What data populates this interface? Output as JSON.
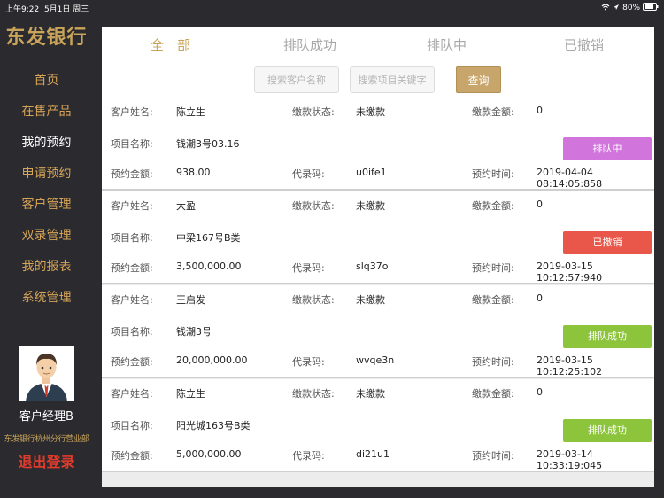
{
  "statusbar": {
    "time": "上午9:22",
    "date": "5月1日 周三",
    "battery": "80%",
    "wifi_icon": "wifi-icon",
    "location_icon": "location-icon",
    "battery_icon": "battery-icon"
  },
  "sidebar": {
    "logo": "东发银行",
    "items": [
      {
        "label": "首页",
        "active": false
      },
      {
        "label": "在售产品",
        "active": false
      },
      {
        "label": "我的预约",
        "active": true
      },
      {
        "label": "申请预约",
        "active": false
      },
      {
        "label": "客户管理",
        "active": false
      },
      {
        "label": "双录管理",
        "active": false
      },
      {
        "label": "我的报表",
        "active": false
      },
      {
        "label": "系统管理",
        "active": false
      }
    ],
    "manager_name": "客户经理B",
    "branch": "东发银行杭州分行营业部",
    "logout": "退出登录"
  },
  "tabs": [
    {
      "label": "全　部",
      "active": true
    },
    {
      "label": "排队成功",
      "active": false
    },
    {
      "label": "排队中",
      "active": false
    },
    {
      "label": "已撤销",
      "active": false
    }
  ],
  "search": {
    "customer_placeholder": "搜索客户名称",
    "project_placeholder": "搜索项目关键字",
    "query_label": "查询"
  },
  "labels": {
    "customer": "客户姓名:",
    "pay_status": "缴款状态:",
    "pay_amount": "缴款金额:",
    "project": "项目名称:",
    "reserve_amount": "预约金额:",
    "agent_code": "代录码:",
    "reserve_time": "预约时间:"
  },
  "colors": {
    "queuing": "#d175dc",
    "cancelled": "#e8574a",
    "success": "#8cc43c",
    "accent": "#c9a45a"
  },
  "reservations": [
    {
      "customer": "陈立生",
      "pay_status": "未缴款",
      "pay_amount": "0",
      "project": "钱潮3号03.16",
      "status": "排队中",
      "status_color": "#d175dc",
      "amount": "938.00",
      "code": "u0ife1",
      "time": "2019-04-04 08:14:05:858"
    },
    {
      "customer": "大盈",
      "pay_status": "未缴款",
      "pay_amount": "0",
      "project": "中梁167号B类",
      "status": "已撤销",
      "status_color": "#e8574a",
      "amount": "3,500,000.00",
      "code": "slq37o",
      "time": "2019-03-15 10:12:57:940"
    },
    {
      "customer": "王启发",
      "pay_status": "未缴款",
      "pay_amount": "0",
      "project": "钱潮3号",
      "status": "排队成功",
      "status_color": "#8cc43c",
      "amount": "20,000,000.00",
      "code": "wvqe3n",
      "time": "2019-03-15 10:12:25:102"
    },
    {
      "customer": "陈立生",
      "pay_status": "未缴款",
      "pay_amount": "0",
      "project": "阳光城163号B类",
      "status": "排队成功",
      "status_color": "#8cc43c",
      "amount": "5,000,000.00",
      "code": "di21u1",
      "time": "2019-03-14 10:33:19:045"
    }
  ]
}
